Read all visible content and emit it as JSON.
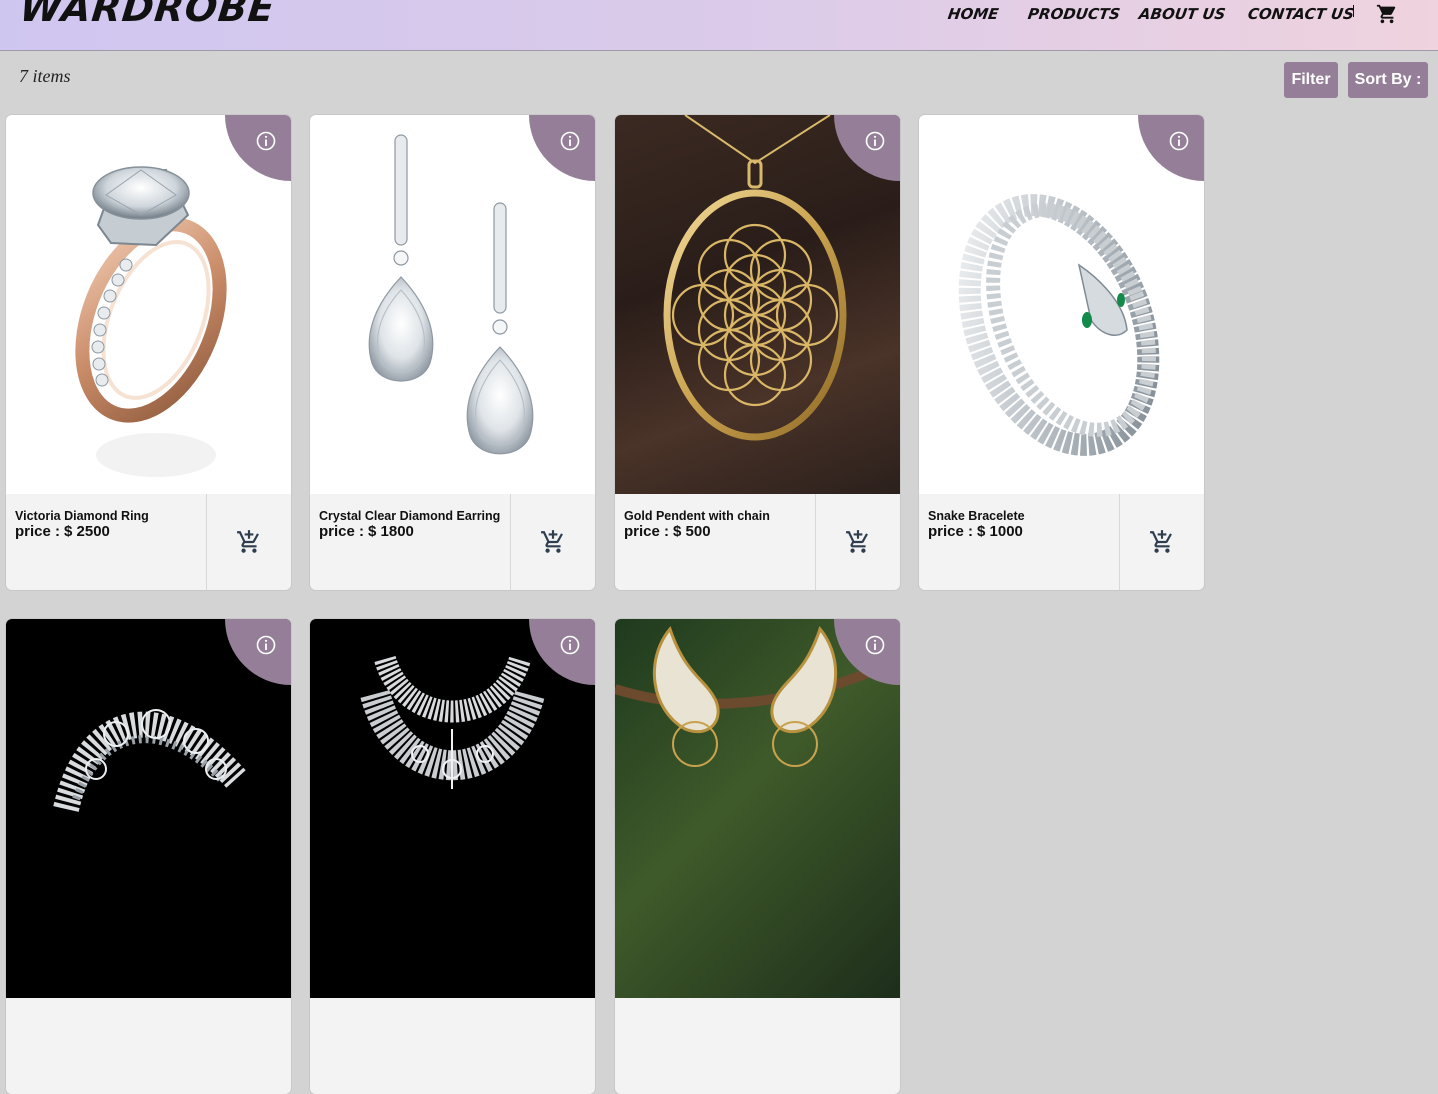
{
  "header": {
    "logo": "WARDROBE",
    "nav": [
      "HOME",
      "PRODUCTS",
      "ABOUT US",
      "CONTACT US"
    ]
  },
  "toolbar": {
    "items_count": "7 items",
    "filter_label": "Filter",
    "sort_label": "Sort By :"
  },
  "products": [
    {
      "name": "Victoria Diamond Ring",
      "price_label": "price :",
      "price": "$ 2500"
    },
    {
      "name": "Crystal Clear Diamond Earring",
      "price_label": "price :",
      "price": "$ 1800"
    },
    {
      "name": "Gold Pendent with chain",
      "price_label": "price :",
      "price": "$ 500"
    },
    {
      "name": "Snake Bracelete",
      "price_label": "price :",
      "price": "$ 1000"
    },
    {
      "name": "",
      "price_label": "",
      "price": ""
    },
    {
      "name": "",
      "price_label": "",
      "price": ""
    },
    {
      "name": "",
      "price_label": "",
      "price": ""
    }
  ],
  "colors": {
    "accent": "#957f98",
    "background": "#d3d3d3",
    "card": "#f3f3f3"
  }
}
